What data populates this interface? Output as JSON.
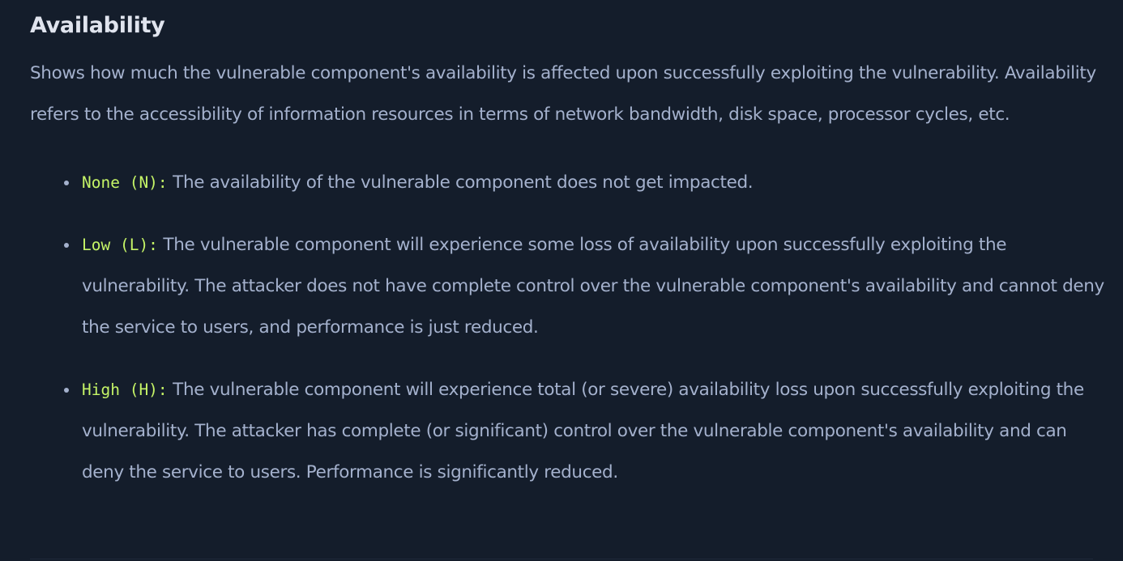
{
  "section": {
    "title": "Availability",
    "intro": "Shows how much the vulnerable component's availability is affected upon successfully exploiting the vulnerability. Availability refers to the accessibility of information resources in terms of network bandwidth, disk space, processor cycles, etc."
  },
  "items": [
    {
      "code": "None (N):",
      "text": " The availability of the vulnerable component does not get impacted."
    },
    {
      "code": "Low (L):",
      "text": " The vulnerable component will experience some loss of availability upon successfully exploiting the vulnerability. The attacker does not have complete control over the vulnerable component's availability and cannot deny the service to users, and performance is just reduced."
    },
    {
      "code": "High (H):",
      "text": " The vulnerable component will experience total (or severe) availability loss upon successfully exploiting the vulnerability. The attacker has complete (or significant) control over the vulnerable component's availability and can deny the service to users. Performance is significantly reduced."
    }
  ],
  "colors": {
    "background": "#141d2b",
    "heading": "#e0e4ee",
    "body_text": "#a4b1cd",
    "code_accent": "#c5f467"
  }
}
